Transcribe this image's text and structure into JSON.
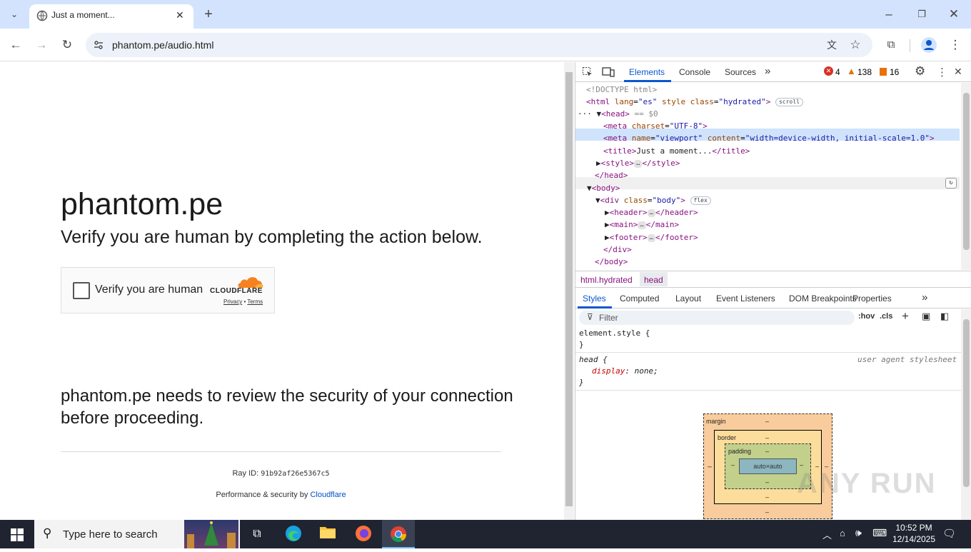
{
  "browser": {
    "tab_title": "Just a moment...",
    "url": "phantom.pe/audio.html"
  },
  "page": {
    "site_name": "phantom.pe",
    "heading": "Verify you are human by completing the action below.",
    "widget": {
      "checkbox_label": "Verify you are human",
      "brand": "CLOUDFLARE",
      "privacy": "Privacy",
      "separator": "•",
      "terms": "Terms"
    },
    "review_text": "phantom.pe needs to review the security of your connection before proceeding.",
    "ray_label": "Ray ID:",
    "ray_id": "91b92af26e5367c5",
    "perf_label": "Performance & security by",
    "perf_link": "Cloudflare"
  },
  "devtools": {
    "tabs": [
      "Elements",
      "Console",
      "Sources"
    ],
    "more": "»",
    "errors": "4",
    "warnings": "138",
    "info": "16",
    "dom": {
      "doctype": "<!DOCTYPE html>",
      "html_open": "<html",
      "html_attrs": [
        {
          "name": "lang",
          "value": "\"es\""
        },
        {
          "name": "style",
          "value": ""
        },
        {
          "name": "class",
          "value": "\"hydrated\""
        }
      ],
      "html_close_bracket": ">",
      "scroll_badge": "scroll",
      "head_open": "<head>",
      "head_eq": "== $0",
      "meta1": "<meta",
      "meta1_attr": "charset",
      "meta1_val": "\"UTF-8\"",
      "meta2": "<meta",
      "meta2_attr1": "name",
      "meta2_val1": "\"viewport\"",
      "meta2_attr2": "content",
      "meta2_val2": "\"width=device-width, initial-scale=1.0\"",
      "title_open": "<title>",
      "title_text": "Just a moment...",
      "title_close": "</title>",
      "style_open": "<style>",
      "style_close": "</style>",
      "head_close": "</head>",
      "body_open": "<body>",
      "div_open": "<div",
      "div_attr": "class",
      "div_val": "\"body\"",
      "flex_badge": "flex",
      "header_open": "<header>",
      "header_close": "</header>",
      "main_open": "<main>",
      "main_close": "</main>",
      "footer_open": "<footer>",
      "footer_close": "</footer>",
      "div_close": "</div>",
      "body_close": "</body>",
      "ellipsis": "…",
      "gt": ">"
    },
    "breadcrumbs": [
      "html.hydrated",
      "head"
    ],
    "style_tabs": [
      "Styles",
      "Computed",
      "Layout",
      "Event Listeners",
      "DOM Breakpoints",
      "Properties"
    ],
    "filter_placeholder": "Filter",
    "hov": ":hov",
    "cls": ".cls",
    "styles": {
      "element_style": "element.style {",
      "close_brace": "}",
      "head_rule": "head {",
      "prop": "display",
      "val": "none;",
      "source": "user agent stylesheet"
    },
    "box_model": {
      "margin": "margin",
      "border": "border",
      "padding": "padding",
      "content": "auto×auto",
      "dash": "–"
    }
  },
  "taskbar": {
    "search_placeholder": "Type here to search",
    "time": "10:52 PM",
    "date": "12/14/2025"
  },
  "watermark": "ANY RUN"
}
